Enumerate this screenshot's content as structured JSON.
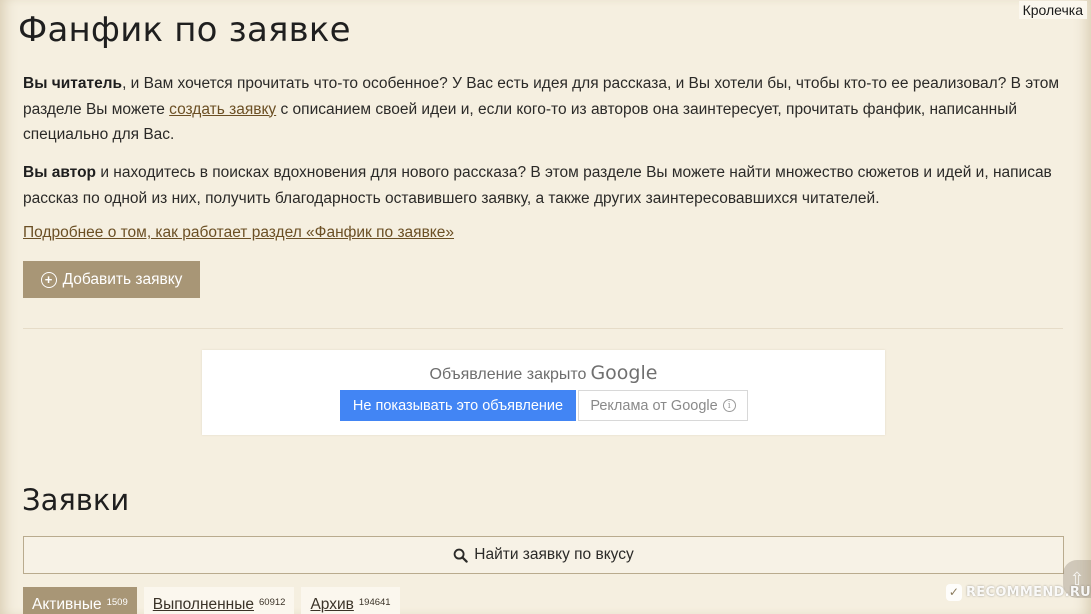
{
  "header": {
    "user_name": "Кролечка",
    "page_title": "Фанфик по заявке"
  },
  "intro": {
    "reader_bold": "Вы читатель",
    "reader_text_1": ", и Вам хочется прочитать что-то особенное? У Вас есть идея для рассказа, и Вы хотели бы, чтобы кто-то ее реализовал? В этом разделе Вы можете ",
    "reader_link": "создать заявку",
    "reader_text_2": " с описанием своей идеи и, если кого-то из авторов она заинтересует, прочитать фанфик, написанный специально для Вас.",
    "author_bold": "Вы автор",
    "author_text": " и находитесь в поисках вдохновения для нового рассказа? В этом разделе Вы можете найти множество сюжетов и идей и, написав рассказ по одной из них, получить благодарность оставившего заявку, а также других заинтересовавшихся читателей.",
    "more_link": "Подробнее о том, как работает раздел «Фанфик по заявке»",
    "add_button": "Добавить заявку"
  },
  "ad": {
    "closed_text": "Объявление закрыто",
    "google_word": "Google",
    "hide_button": "Не показывать это объявление",
    "ads_by_button": "Реклама от Google"
  },
  "requests": {
    "section_title": "Заявки",
    "search_button": "Найти заявку по вкусу",
    "tabs": [
      {
        "label": "Активные",
        "count": "1509",
        "active": true
      },
      {
        "label": "Выполненные",
        "count": "60912",
        "active": false
      },
      {
        "label": "Архив",
        "count": "194641",
        "active": false
      }
    ]
  },
  "watermark": {
    "text": "RECOMMEND.RU"
  },
  "colors": {
    "background": "#f5efe0",
    "accent": "#a89676",
    "link": "#6b4f24",
    "ad_button": "#4285f4"
  }
}
